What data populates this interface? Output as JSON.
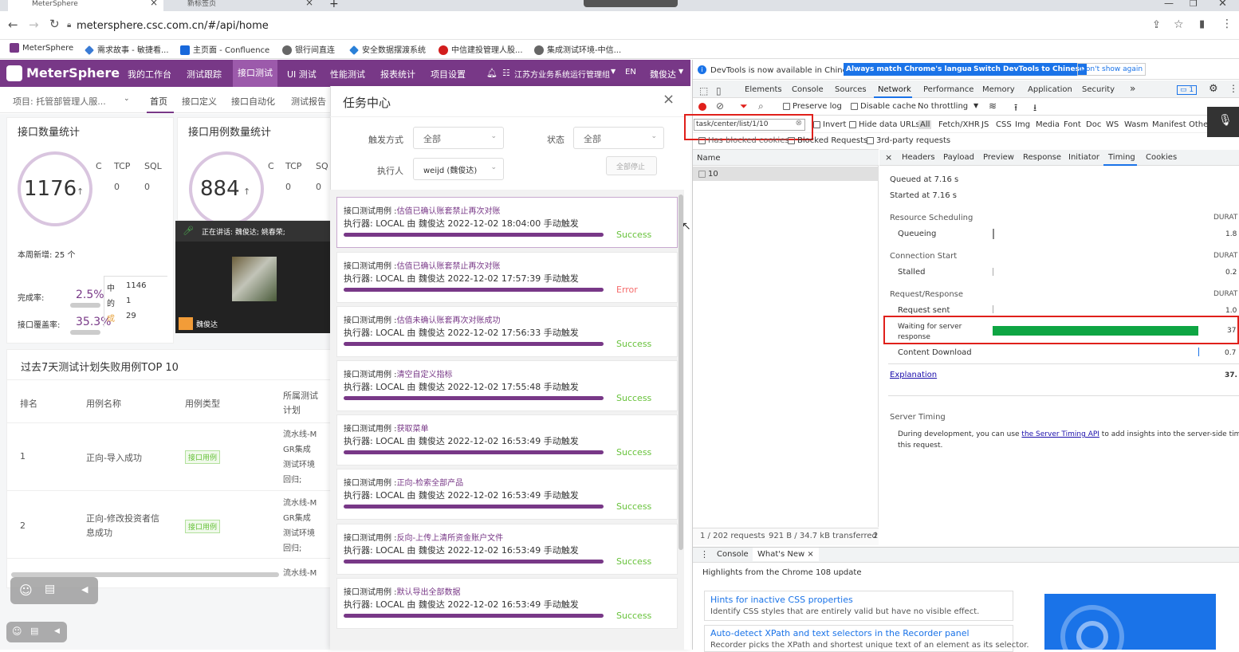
{
  "browser": {
    "tabs": [
      {
        "label": "MeterSphere",
        "close": "×"
      },
      {
        "label": "新标签页",
        "close": "×"
      }
    ],
    "new_tab": "+",
    "url": "metersphere.csc.com.cn/#/api/home",
    "bookmarks": [
      "MeterSphere",
      "需求故事 - 敏捷看...",
      "主页面 - Confluence",
      "银行间直连",
      "安全数据摆渡系统",
      "中信建投管理人股...",
      "集成测试环境-中信..."
    ]
  },
  "app": {
    "logo": "MeterSphere",
    "nav": [
      "我的工作台",
      "测试跟踪",
      "接口测试",
      "UI 测试",
      "性能测试",
      "报表统计",
      "项目设置"
    ],
    "active_nav": "接口测试",
    "workspace": "江苏方业务系统运行管理组",
    "lang": "EN",
    "user": "魏俊达",
    "project": "项目: 托管部管理人服...",
    "subnav": [
      "首页",
      "接口定义",
      "接口自动化",
      "测试报告"
    ]
  },
  "stats": {
    "api_title": "接口数量统计",
    "api_count": "1176",
    "api_cols": [
      "C",
      "TCP",
      "SQL"
    ],
    "api_vals": [
      "0",
      "0"
    ],
    "weekly": "本周新增: 25 个",
    "complete_label": "完成率:",
    "complete": "2.5%",
    "cover_label": "接口覆盖率:",
    "cover": "35.3%",
    "case_title": "接口用例数量统计",
    "case_count": "884",
    "case_cols": [
      "C",
      "TCP",
      "SQ"
    ],
    "case_vals": [
      "0",
      "0"
    ],
    "side": [
      {
        "k": "中",
        "v": "1146"
      },
      {
        "k": "的",
        "v": "1"
      },
      {
        "k": "成",
        "v": "29"
      }
    ]
  },
  "video": {
    "speaking": "正在讲话: 魏俊达; 姚春荣;",
    "name": "魏俊达"
  },
  "top10": {
    "title": "过去7天测试计划失败用例TOP 10",
    "headers": [
      "排名",
      "用例名称",
      "用例类型",
      "所属测试\n计划"
    ],
    "rows": [
      {
        "rank": "1",
        "name": "正向-导入成功",
        "type": "接口用例",
        "plan": "流水线-M\nGR集成\n测试环境\n回归;"
      },
      {
        "rank": "2",
        "name": "正向-修改投资者信\n息成功",
        "type": "接口用例",
        "plan": "流水线-M\nGR集成\n测试环境\n回归;"
      },
      {
        "rank": "",
        "name": "",
        "type": "",
        "plan": "流水线-M"
      }
    ]
  },
  "task": {
    "title": "任务中心",
    "close": "×",
    "trigger_label": "触发方式",
    "trigger": "全部",
    "status_label": "状态",
    "status": "全部",
    "exec_label": "执行人",
    "exec": "weijd (魏俊达)",
    "stop_all": "全部停止",
    "items": [
      {
        "prefix": "接口测试用例 :",
        "name": "估值已确认账套禁止再次对账",
        "exec": "执行器:  LOCAL 由 魏俊达 2022-12-02 18:04:00 手动触发",
        "status": "Success",
        "ok": true
      },
      {
        "prefix": "接口测试用例 :",
        "name": "估值已确认账套禁止再次对账",
        "exec": "执行器:  LOCAL 由 魏俊达 2022-12-02 17:57:39 手动触发",
        "status": "Error",
        "ok": false
      },
      {
        "prefix": "接口测试用例 :",
        "name": "估值未确认账套再次对账成功",
        "exec": "执行器:  LOCAL 由 魏俊达 2022-12-02 17:56:33 手动触发",
        "status": "Success",
        "ok": true
      },
      {
        "prefix": "接口测试用例 :",
        "name": "清空自定义指标",
        "exec": "执行器:  LOCAL 由 魏俊达 2022-12-02 17:55:48 手动触发",
        "status": "Success",
        "ok": true
      },
      {
        "prefix": "接口测试用例 :",
        "name": "获取菜单",
        "exec": "执行器:  LOCAL 由 魏俊达 2022-12-02 16:53:49 手动触发",
        "status": "Success",
        "ok": true
      },
      {
        "prefix": "接口测试用例 :",
        "name": "正向-检索全部产品",
        "exec": "执行器:  LOCAL 由 魏俊达 2022-12-02 16:53:49 手动触发",
        "status": "Success",
        "ok": true
      },
      {
        "prefix": "接口测试用例 :",
        "name": "反向-上传上清所资金账户文件",
        "exec": "执行器:  LOCAL 由 魏俊达 2022-12-02 16:53:49 手动触发",
        "status": "Success",
        "ok": true
      },
      {
        "prefix": "接口测试用例 :",
        "name": "默认导出全部数据",
        "exec": "执行器:  LOCAL 由 魏俊达 2022-12-02 16:53:49 手动触发",
        "status": "Success",
        "ok": true
      }
    ]
  },
  "devtools": {
    "banner": "DevTools is now available in Chinese!",
    "btn_match": "Always match Chrome's language",
    "btn_switch": "Switch DevTools to Chinese",
    "btn_dont": "Don't show again",
    "tabs": [
      "Elements",
      "Console",
      "Sources",
      "Network",
      "Performance",
      "Memory",
      "Application",
      "Security"
    ],
    "active": "Network",
    "more": "»",
    "badge": "1",
    "preserve": "Preserve log",
    "disable_cache": "Disable cache",
    "throttle": "No throttling",
    "filter": "task/center/list/1/10",
    "invert": "Invert",
    "hide_data": "Hide data URLs",
    "types": [
      "All",
      "Fetch/XHR",
      "JS",
      "CSS",
      "Img",
      "Media",
      "Font",
      "Doc",
      "WS",
      "Wasm",
      "Manifest",
      "Othe"
    ],
    "blocked_cookies": "Has blocked cookies",
    "blocked_req": "Blocked Requests",
    "third": "3rd-party requests",
    "name_col": "Name",
    "req_name": "10",
    "detail_tabs": [
      "Headers",
      "Payload",
      "Preview",
      "Response",
      "Initiator",
      "Timing",
      "Cookies"
    ],
    "detail_active": "Timing",
    "queued": "Queued at 7.16 s",
    "started": "Started at 7.16 s",
    "sections": [
      {
        "h": "Resource Scheduling",
        "d": "DURAT",
        "rows": [
          {
            "n": "Queueing",
            "v": "1.8"
          }
        ]
      },
      {
        "h": "Connection Start",
        "d": "DURAT",
        "rows": [
          {
            "n": "Stalled",
            "v": "0.2"
          }
        ]
      },
      {
        "h": "Request/Response",
        "d": "DURAT",
        "rows": [
          {
            "n": "Request sent",
            "v": "1.0"
          },
          {
            "n": "Waiting for server\nresponse",
            "v": "37"
          },
          {
            "n": "Content Download",
            "v": "0.7"
          }
        ]
      }
    ],
    "explanation": "Explanation",
    "total": "37.",
    "server_timing": "Server Timing",
    "st_text1": "During development, you can use ",
    "st_link": "the Server Timing API",
    "st_text2": " to add insights into the server-side timin",
    "st_text3": "this request.",
    "status_req": "1 / 202 requests",
    "status_transfer": "921 B / 34.7 kB transferred",
    "status_more": "2",
    "drawer_tabs": [
      "Console",
      "What's New"
    ],
    "drawer_active": "What's New",
    "highlights": "Highlights from the Chrome 108 update",
    "cards": [
      {
        "t": "Hints for inactive CSS properties",
        "d": "Identify CSS styles that are entirely valid but have no visible effect."
      },
      {
        "t": "Auto-detect XPath and text selectors in the Recorder panel",
        "d": "Recorder picks the XPath and shortest unique text of an element as its selector."
      }
    ]
  }
}
